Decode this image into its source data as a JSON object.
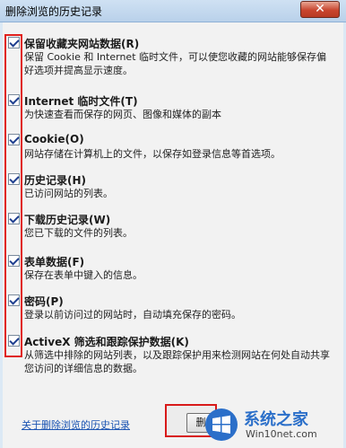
{
  "window": {
    "title": "删除浏览的历史记录",
    "close_glyph": "✕"
  },
  "items": [
    {
      "title": "保留收藏夹网站数据(R)",
      "desc": "保留 Cookie 和 Internet 临时文件，可以使您收藏的网站能够保存偏好选项并提高显示速度。",
      "checked": true
    },
    {
      "title": "Internet 临时文件(T)",
      "desc": "为快速查看而保存的网页、图像和媒体的副本",
      "checked": true
    },
    {
      "title": "Cookie(O)",
      "desc": "网站存储在计算机上的文件，以保存如登录信息等首选项。",
      "checked": true
    },
    {
      "title": "历史记录(H)",
      "desc": "已访问网站的列表。",
      "checked": true
    },
    {
      "title": "下载历史记录(W)",
      "desc": "您已下载的文件的列表。",
      "checked": true
    },
    {
      "title": "表单数据(F)",
      "desc": "保存在表单中键入的信息。",
      "checked": true
    },
    {
      "title": "密码(P)",
      "desc": "登录以前访问过的网站时，自动填充保存的密码。",
      "checked": true
    },
    {
      "title": "ActiveX 筛选和跟踪保护数据(K)",
      "desc": "从筛选中排除的网站列表，以及跟踪保护用来检测网站在何处自动共享您访问的详细信息的数据。",
      "checked": true
    }
  ],
  "footer": {
    "link": "关于删除浏览的历史记录",
    "delete_button": "删"
  },
  "watermark": {
    "brand": "系统之家",
    "url": "Win10net.com"
  },
  "colors": {
    "highlight": "#e0201c",
    "link": "#1c55b3",
    "accent": "#2b6fc9"
  }
}
